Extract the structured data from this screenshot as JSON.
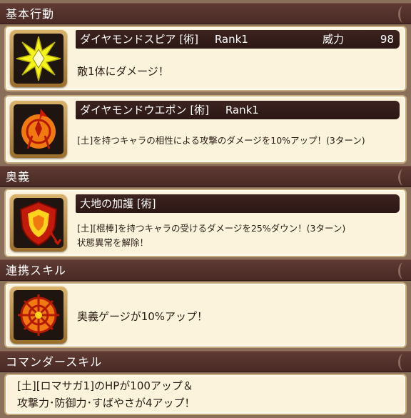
{
  "sections": {
    "basic": "基本行動",
    "ougi": "奥義",
    "renkei": "連携スキル",
    "commander": "コマンダースキル"
  },
  "skills": [
    {
      "name": "ダイヤモンドスピア [術]",
      "rank": "Rank1",
      "power_label": "威力",
      "power_value": "98",
      "desc": [
        "敵1体にダメージ！"
      ],
      "icon": "diamond-spear-icon"
    },
    {
      "name": "ダイヤモンドウエポン [術]",
      "rank": "Rank1",
      "desc": [
        "[土]を持つキャラの相性による攻撃のダメージを10%アップ！(3ターン)"
      ],
      "icon": "diamond-weapon-icon"
    },
    {
      "name": "大地の加護 [術]",
      "desc": [
        "[土][棍棒]を持つキャラの受けるダメージを25%ダウン！(3ターン)",
        "状態異常を解除！"
      ],
      "icon": "earth-shield-icon"
    }
  ],
  "renkei": {
    "desc": "奥義ゲージが10%アップ！",
    "icon": "burst-gauge-icon"
  },
  "commander": {
    "line1": "[土][ロマサガ1]のHPが100アップ＆",
    "line2": "攻撃力･防御力･すばやさが4アップ！"
  },
  "colors": {
    "header_bg": "#4a2a25",
    "card_bg": "#fbf3dc",
    "frame": "#c8ab7c"
  }
}
